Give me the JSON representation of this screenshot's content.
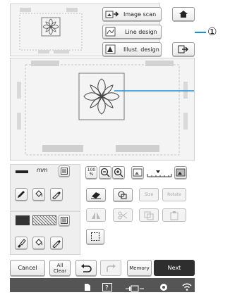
{
  "toolbar": {
    "image_scan": "Image scan",
    "line_design": "Line design",
    "illust_design": "Illust. design"
  },
  "callout": {
    "number": "①"
  },
  "line_tools": {
    "width_label": "mm"
  },
  "zoom": {
    "level_top": "100",
    "level_bottom": "%"
  },
  "edit": {
    "size": "Size",
    "rotate": "Rotate"
  },
  "footer": {
    "cancel": "Cancel",
    "all_clear_1": "All",
    "all_clear_2": "Clear",
    "memory": "Memory",
    "next": "Next"
  },
  "colors": {
    "accent": "#1a8fd6",
    "next_btn": "#2e2e2e",
    "statusbar": "#555555"
  }
}
